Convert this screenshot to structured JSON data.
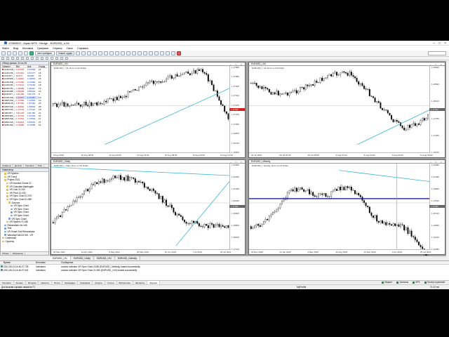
{
  "window": {
    "title": "17083522 - Alpari-MT5 - Hedge - EURUSD_s,H1"
  },
  "menu": [
    "Файл",
    "Вид",
    "Вставка",
    "Графики",
    "Сервис",
    "Окно",
    "Справка"
  ],
  "toolbar": {
    "algo": "Автотрейдинг",
    "new_order": "Новый ордер"
  },
  "market_watch": {
    "title": "Обзор рынка: 24 из 25",
    "headers": [
      "Символ",
      "Bid",
      "Ask",
      "Спрэд"
    ],
    "rows": [
      [
        "AUDCAD_i",
        "0.97945",
        "0.97966",
        "21"
      ],
      [
        "AUDCHF_i",
        "0.67461",
        "0.67477",
        "16"
      ],
      [
        "AUDJPY_i",
        "80.971",
        "80.985",
        "14"
      ],
      [
        "AUDNZD_i",
        "1.04810",
        "1.04833",
        "23"
      ],
      [
        "AUDUSD_i",
        "0.73450",
        "0.73460",
        "10"
      ],
      [
        "CADCHF_i",
        "0.73142",
        "0.73160",
        "18"
      ],
      [
        "EURCHF_i",
        "1.08398",
        "1.08411",
        "13"
      ],
      [
        "EURGBP_i",
        "0.85308",
        "0.85318",
        "10"
      ],
      [
        "EURJPY_i",
        "129.466",
        "129.475",
        "9"
      ],
      [
        "EURUSD_i",
        "1.17447",
        "1.17457",
        "10"
      ],
      [
        "GBPUSD_i",
        "1.37682",
        "1.37694",
        "12"
      ],
      [
        "GBPAUD_i",
        "1.87452",
        "1.87481",
        "29"
      ],
      [
        "GBPCAD_i",
        "1.83602",
        "1.83630",
        "28"
      ],
      [
        "GBPCHF_i",
        "1.27104",
        "1.27122",
        "18"
      ],
      [
        "GBPJPY_i",
        "152.229",
        "152.250",
        "21"
      ],
      [
        "GBPNZD_i",
        "1.97193",
        "1.97230",
        "37"
      ],
      [
        "GBPUSD_i",
        "1.37681",
        "1.37692",
        "11"
      ],
      [
        "NZDCAD_i",
        "0.93443",
        "0.93470",
        "27"
      ],
      [
        "NZDUSD_i",
        "0.70086",
        "0.70098",
        "12"
      ]
    ],
    "tabs": [
      "Символы",
      "Детали",
      "Торговля",
      "Тики"
    ]
  },
  "navigator": {
    "title": "Навигатор",
    "items": [
      {
        "label": "VR System",
        "lvl": 1,
        "t": "f"
      },
      {
        "label": "VR Trend",
        "lvl": 1,
        "t": "f"
      },
      {
        "label": "Project 2021",
        "lvl": 1,
        "t": "f"
      },
      {
        "label": "VR Avoided Charts 21",
        "lvl": 2,
        "t": "f"
      },
      {
        "label": "VR Calculate Martingale",
        "lvl": 2,
        "t": "f"
      },
      {
        "label": "VR Calc 21.040",
        "lvl": 2,
        "t": "f"
      },
      {
        "label": "VR Pivot 21.030",
        "lvl": 2,
        "t": "f"
      },
      {
        "label": "VR Sync Chart 21.070",
        "lvl": 2,
        "t": "f"
      },
      {
        "label": "VR Sync Chart 21.080",
        "lvl": 2,
        "t": "f"
      },
      {
        "label": "Sources",
        "lvl": 3,
        "t": "f"
      },
      {
        "label": "VR Sync Chart",
        "lvl": 4,
        "t": "s"
      },
      {
        "label": "VR Sync Chart",
        "lvl": 4,
        "t": "s"
      },
      {
        "label": "VR Sync Chart",
        "lvl": 4,
        "t": "s"
      },
      {
        "label": "VR Sync Chart",
        "lvl": 4,
        "t": "s"
      },
      {
        "label": "VR Sync Chart",
        "lvl": 3,
        "t": "s"
      },
      {
        "label": "VR System 21.045",
        "lvl": 2,
        "t": "f"
      },
      {
        "label": "Retranslator for mt5",
        "lvl": 1,
        "t": "s"
      },
      {
        "label": "Test",
        "lvl": 1,
        "t": "s"
      },
      {
        "label": "VR Smart Grid Retranslator",
        "lvl": 1,
        "t": "s"
      },
      {
        "label": "WaveAlpf MACD M5 - VR",
        "lvl": 1,
        "t": "s"
      },
      {
        "label": "Советники",
        "lvl": 0,
        "t": "f"
      },
      {
        "label": "Скрипты",
        "lvl": 0,
        "t": "f"
      }
    ],
    "tabs": [
      "Общие",
      "Избранное"
    ]
  },
  "charts": [
    {
      "id": "c1",
      "title": "EURUSD_i,H1",
      "label": "EURUSD_i, H1: Euro vs US Dollar",
      "y": [
        "1.17835",
        "1.17680",
        "1.17545",
        "1.17410",
        "1.17275",
        "1.17140",
        "1.17005",
        "1.16870",
        "1.16735",
        "1.16600"
      ],
      "x": [
        "9 Aug 2021",
        "10 Aug 08:00",
        "11 Aug 00:00",
        "11 Aug 16:00",
        "12 Aug 08:00",
        "13 Aug 00:00",
        "13 Aug 12:00"
      ],
      "price": "1.17447",
      "seed": 3,
      "trend": "up"
    },
    {
      "id": "c2",
      "title": "EURUSD_i,H4",
      "label": "EURUSD_i, H4: Euro vs US Dollar",
      "y": [
        "1.18920",
        "1.18530",
        "1.18140",
        "1.17750",
        "1.17360",
        "1.16970"
      ],
      "x": [
        "22 Jul 2021",
        "26 Jul 20:00",
        "29 Jul 08:00",
        "3 Aug 16:00",
        "5 Aug 04:00",
        "9 Aug 20:00",
        "12 Aug 08:00"
      ],
      "price": "1.17447",
      "seed": 7,
      "trend": "down"
    },
    {
      "id": "c3",
      "title": "EURUSD_i,Daily",
      "label": "EURUSD_i, Daily: Euro vs US Dollar",
      "y": [
        "1.22845",
        "1.22040",
        "1.21235",
        "1.20430",
        "1.19625",
        "1.18820",
        "1.18015",
        "1.17210"
      ],
      "x": [
        "26 Mar 2021",
        "14 Apr 2021",
        "5 May 2021",
        "26 May 2021",
        "16 Jun 2021",
        "7 Jul 2021",
        "29 Jul 2021"
      ],
      "price": "1.17447",
      "seed": 11,
      "trend": "rise-fall"
    },
    {
      "id": "c4",
      "title": "EURUSD_i,Weekly",
      "label": "EURUSD_i, Weekly: Euro vs US Dollar",
      "y": [
        "1.23280",
        "1.21390",
        "1.19500",
        "1.17610",
        "1.15720",
        "1.13830",
        "1.11940",
        "1.10050"
      ],
      "x": [
        "20 Dec 2020",
        "12 Jan 2020",
        "3 May 2020",
        "23 Aug 2020",
        "13 Dec 2020",
        "4 Apr 2021",
        "25 Jul 2021"
      ],
      "price": "1.17447",
      "seed": 19,
      "trend": "wave"
    }
  ],
  "chart_tabs": [
    "EURUSD_i,H1",
    "EURUSD_i,Daily",
    "EURUSD_i,H4",
    "EURUSD_i,Weekly"
  ],
  "toolbox": {
    "headers": [
      "Время",
      "Источник",
      "Сообщение"
    ],
    "rows": [
      [
        "2021.08.13 14:46:27.728",
        "Indicators",
        "custom indicator VR Sync Chart 20.85 (EURUSD_i,Weekly) loaded successfully"
      ],
      [
        "2021.08.13 14:46:27.542",
        "Indicators",
        "custom indicator VR Sync Chart 21.080 (EURUSD_i,H4) loaded successfully"
      ]
    ],
    "tabs": [
      "Торговля",
      "Активы",
      "История",
      "Новости",
      "Почта",
      "Календарь",
      "Компания",
      "Алерты",
      "Статьи",
      "Библиотека",
      "Эксперты",
      "Журнал"
    ],
    "active_tab": "Журнал",
    "right": [
      "Маркет",
      "Сигналы",
      "VPS",
      "Тестер стратегий"
    ]
  },
  "status": {
    "left": "Для вызова справки нажмите F1",
    "mid": "MyProfile",
    "right": "71.02 ms"
  }
}
